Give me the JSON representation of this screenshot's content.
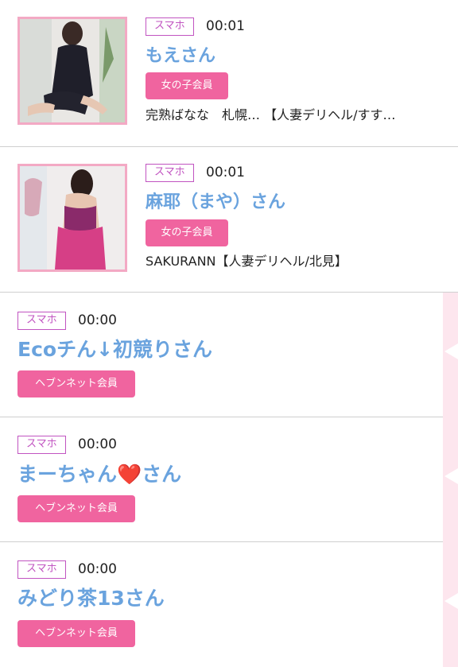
{
  "posts": [
    {
      "device": "スマホ",
      "time": "00:01",
      "name": "もえさん",
      "role": "女の子会員",
      "shop": "完熟ばなな　札幌…  【人妻デリヘル/すす…"
    },
    {
      "device": "スマホ",
      "time": "00:01",
      "name": "麻耶（まや）さん",
      "role": "女の子会員",
      "shop": "SAKURANN【人妻デリヘル/北見】"
    },
    {
      "device": "スマホ",
      "time": "00:00",
      "name": "Ecoチん↓初競りさん",
      "role": "ヘブンネット会員"
    },
    {
      "device": "スマホ",
      "time": "00:00",
      "name": "まーちゃん❤️さん",
      "role": "ヘブンネット会員"
    },
    {
      "device": "スマホ",
      "time": "00:00",
      "name": "みどり茶13さん",
      "role": "ヘブンネット会員"
    }
  ],
  "colors": {
    "name": "#6aa3de",
    "role_badge": "#f0649f",
    "device_badge": "#c154c1",
    "thumb_border": "#f3a9c4",
    "side_strip": "#fde6ee"
  }
}
